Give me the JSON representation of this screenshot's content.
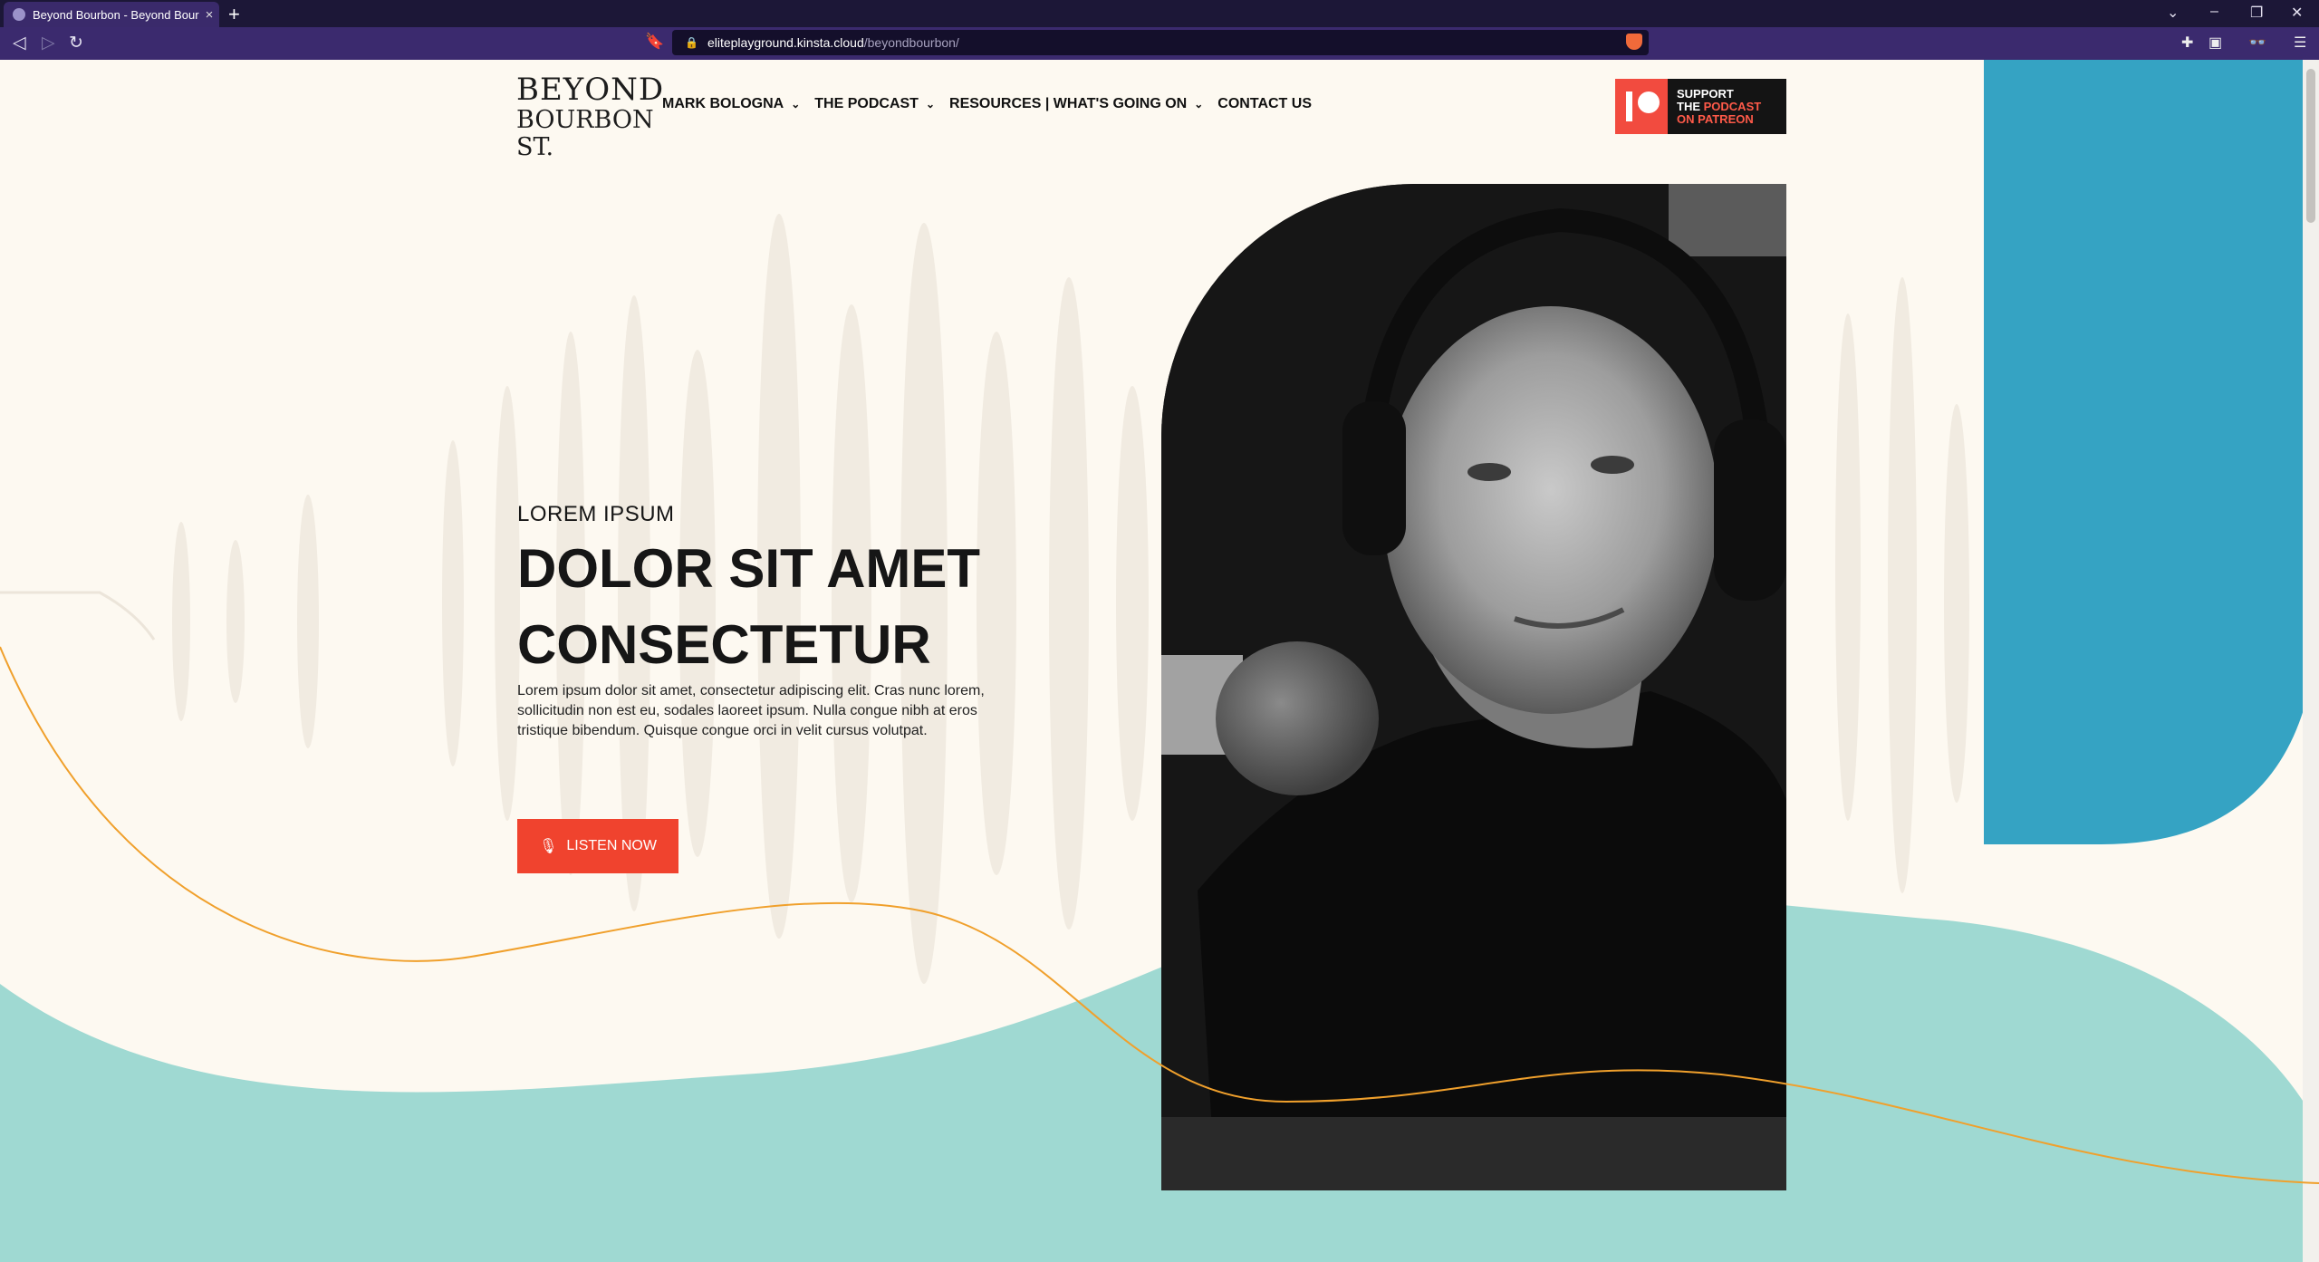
{
  "browser": {
    "tab_title": "Beyond Bourbon - Beyond Bourb",
    "tab_close": "×",
    "new_tab": "+",
    "url_host": "eliteplayground.kinsta.cloud",
    "url_path": "/beyondbourbon/",
    "lock": "🔒",
    "back": "◁",
    "forward": "▷",
    "reload": "↻",
    "bookmark": "🔖",
    "window_controls": [
      "⌄",
      "–",
      "❐",
      "✕"
    ],
    "right_tools": [
      "✚",
      "▣",
      "👓",
      "☰"
    ]
  },
  "site": {
    "logo_line1": "BEYOND",
    "logo_line2": "BOURBON ST.",
    "nav": [
      {
        "label": "MARK BOLOGNA",
        "chevron": "⌄"
      },
      {
        "label": "THE PODCAST",
        "chevron": "⌄"
      },
      {
        "label": "RESOURCES | WHAT'S GOING ON",
        "chevron": "⌄"
      },
      {
        "label": "CONTACT US",
        "chevron": ""
      }
    ],
    "patreon": {
      "line1": "SUPPORT",
      "line2a": "THE ",
      "line2b": "PODCAST",
      "line3": "ON PATREON"
    }
  },
  "hero": {
    "eyebrow": "LOREM IPSUM",
    "headline_line1": "DOLOR SIT AMET",
    "headline_line2": "CONSECTETUR",
    "body": "Lorem ipsum dolor sit amet, consectetur adipiscing elit. Cras nunc lorem, sollicitudin non est eu, sodales laoreet ipsum. Nulla congue nibh at eros tristique bibendum. Quisque congue orci in velit cursus volutpat.",
    "cta_label": "LISTEN NOW",
    "cta_icon": "🎙"
  },
  "colors": {
    "page_bg": "#fdf9f1",
    "teal_light": "#9fd9d2",
    "teal_dark": "#35a3c3",
    "orange_line": "#f0a02c",
    "cta": "#f0432e",
    "browser_bar": "#3b2a6e"
  }
}
